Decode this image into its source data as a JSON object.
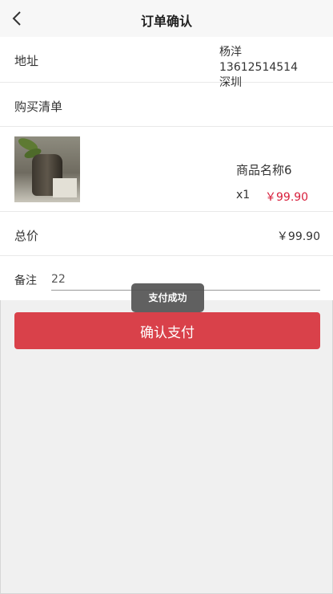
{
  "header": {
    "title": "订单确认",
    "back_icon": "chevron-left-icon"
  },
  "address": {
    "label": "地址",
    "name_phone": "杨洋 13612514514",
    "city": "深圳"
  },
  "purchase_list": {
    "label": "购买清单"
  },
  "product": {
    "image_icon": "product-thumbnail",
    "name": "商品名称6",
    "quantity": "x1",
    "price": "￥99.90"
  },
  "total": {
    "label": "总价",
    "value": "￥99.90"
  },
  "note": {
    "label": "备注",
    "value": "22"
  },
  "actions": {
    "pay_label": "确认支付"
  },
  "toast": {
    "text": "支付成功"
  },
  "colors": {
    "accent": "#d9414a",
    "price": "#d81e3b",
    "toast_bg": "#505050"
  }
}
